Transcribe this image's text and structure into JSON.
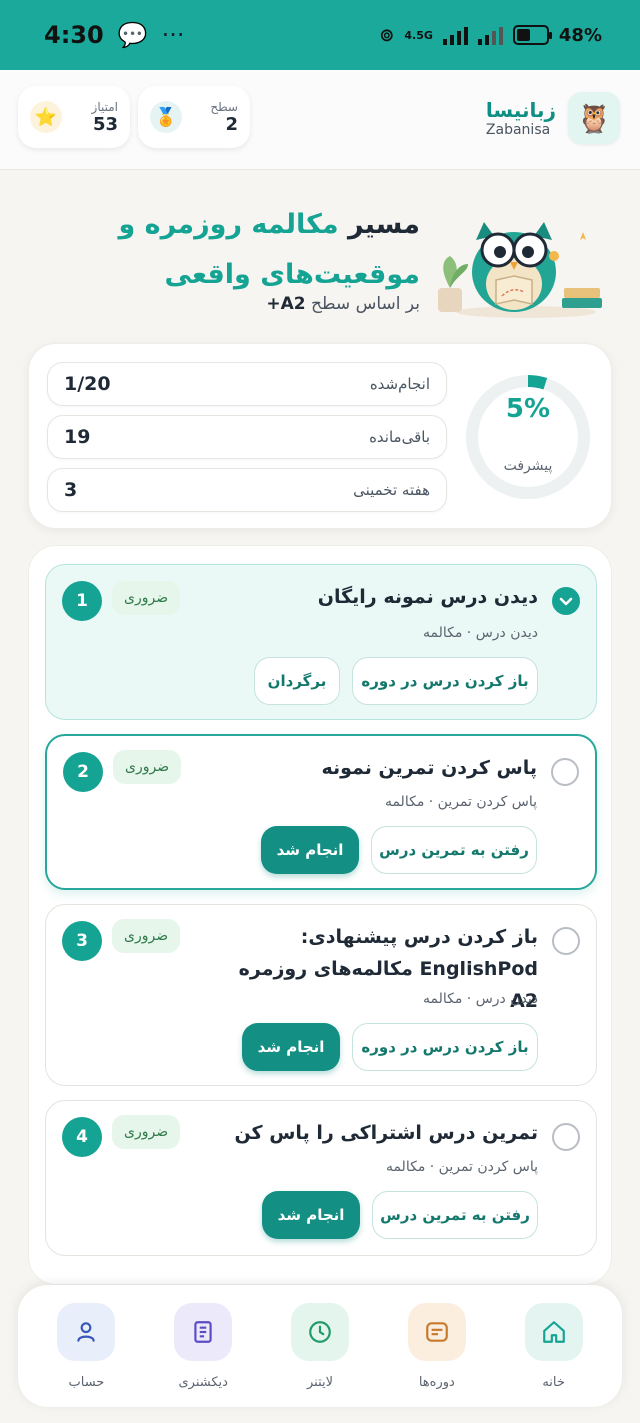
{
  "status_bar": {
    "time": "4:30",
    "network": "4.5G",
    "battery": "48%",
    "battery_level": 0.48
  },
  "header": {
    "brand_fa": "زبانیسا",
    "brand_en": "Zabanisa",
    "level": {
      "label": "سطح",
      "value": "2"
    },
    "points": {
      "label": "امتیاز",
      "value": "53"
    }
  },
  "hero": {
    "title_prefix": "مسیر",
    "title_accent": "مکالمه روزمره و موقعیت‌های واقعی",
    "subtitle_prefix": "بر اساس سطح",
    "level_tag": "+A2"
  },
  "progress": {
    "percent_text": "5%",
    "percent": 5,
    "label": "پیشرفت",
    "rows": [
      {
        "key": "انجام‌شده",
        "value": "1/20"
      },
      {
        "key": "باقی‌مانده",
        "value": "19"
      },
      {
        "key": "هفته تخمینی",
        "value": "3"
      }
    ]
  },
  "tasks": [
    {
      "number": "1",
      "badge": "ضروری",
      "title": "دیدن درس نمونه رایگان",
      "meta": "دیدن درس · مکالمه",
      "primary": "باز کردن درس در دوره",
      "secondary": "برگردان",
      "done": true
    },
    {
      "number": "2",
      "badge": "ضروری",
      "title": "پاس کردن تمرین نمونه",
      "meta": "پاس کردن تمرین · مکالمه",
      "primary": "رفتن به تمرین درس",
      "secondary": "انجام شد",
      "done": false
    },
    {
      "number": "3",
      "badge": "ضروری",
      "title": "باز کردن درس پیشنهادی: EnglishPod مکالمه‌های روزمره A2",
      "meta": "دیدن درس · مکالمه",
      "primary": "باز کردن درس در دوره",
      "secondary": "انجام شد",
      "done": false
    },
    {
      "number": "4",
      "badge": "ضروری",
      "title": "تمرین درس اشتراکی را پاس کن",
      "meta": "پاس کردن تمرین · مکالمه",
      "primary": "رفتن به تمرین درس",
      "secondary": "انجام شد",
      "done": false
    }
  ],
  "nav": [
    {
      "label": "خانه",
      "icon": "home-icon",
      "color": "#e4f5f1",
      "stroke": "#15a394"
    },
    {
      "label": "دوره‌ها",
      "icon": "courses-icon",
      "color": "#fbeede",
      "stroke": "#c77a2c"
    },
    {
      "label": "لایتنر",
      "icon": "leitner-icon",
      "color": "#e3f5ec",
      "stroke": "#1f9a68"
    },
    {
      "label": "دیکشنری",
      "icon": "dictionary-icon",
      "color": "#ece9fb",
      "stroke": "#5b4cc4"
    },
    {
      "label": "حساب",
      "icon": "account-icon",
      "color": "#e9eefb",
      "stroke": "#3856b8"
    }
  ],
  "colors": {
    "brand": "#1aa99a",
    "accent": "#15a394",
    "button": "#138f84"
  }
}
